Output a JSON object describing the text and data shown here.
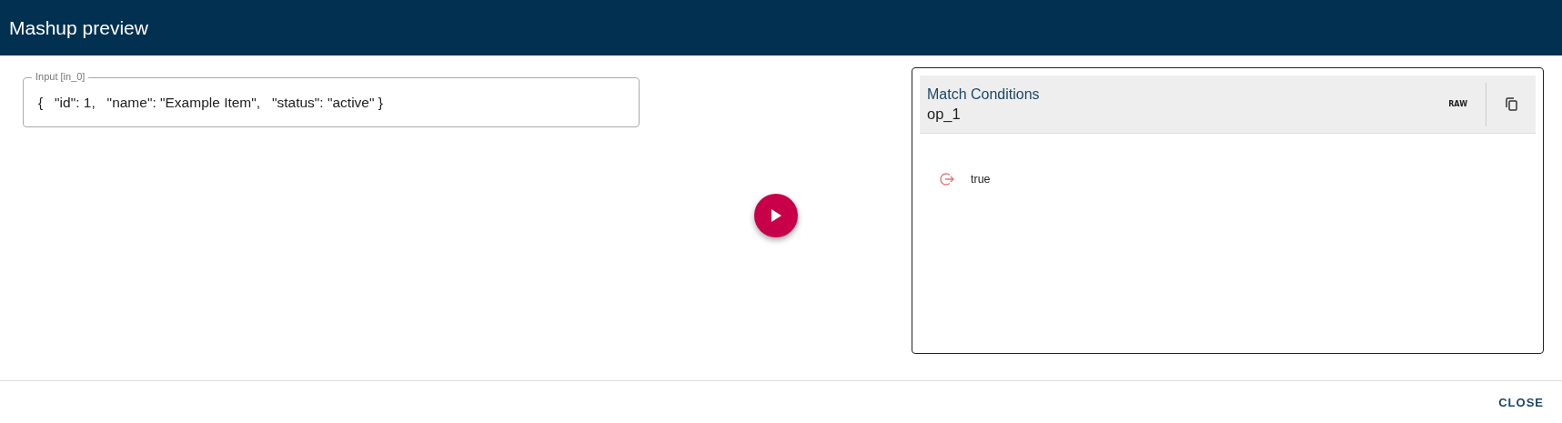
{
  "window": {
    "title": "Mashup preview"
  },
  "input": {
    "label": "Input [in_0]",
    "value": "{   \"id\": 1,   \"name\": \"Example Item\",   \"status\": \"active\" }"
  },
  "output": {
    "title": "Match Conditions",
    "operator": "op_1",
    "raw_label": "RAW",
    "results": [
      {
        "text": "true"
      }
    ]
  },
  "buttons": [
    "CLOSE"
  ]
}
